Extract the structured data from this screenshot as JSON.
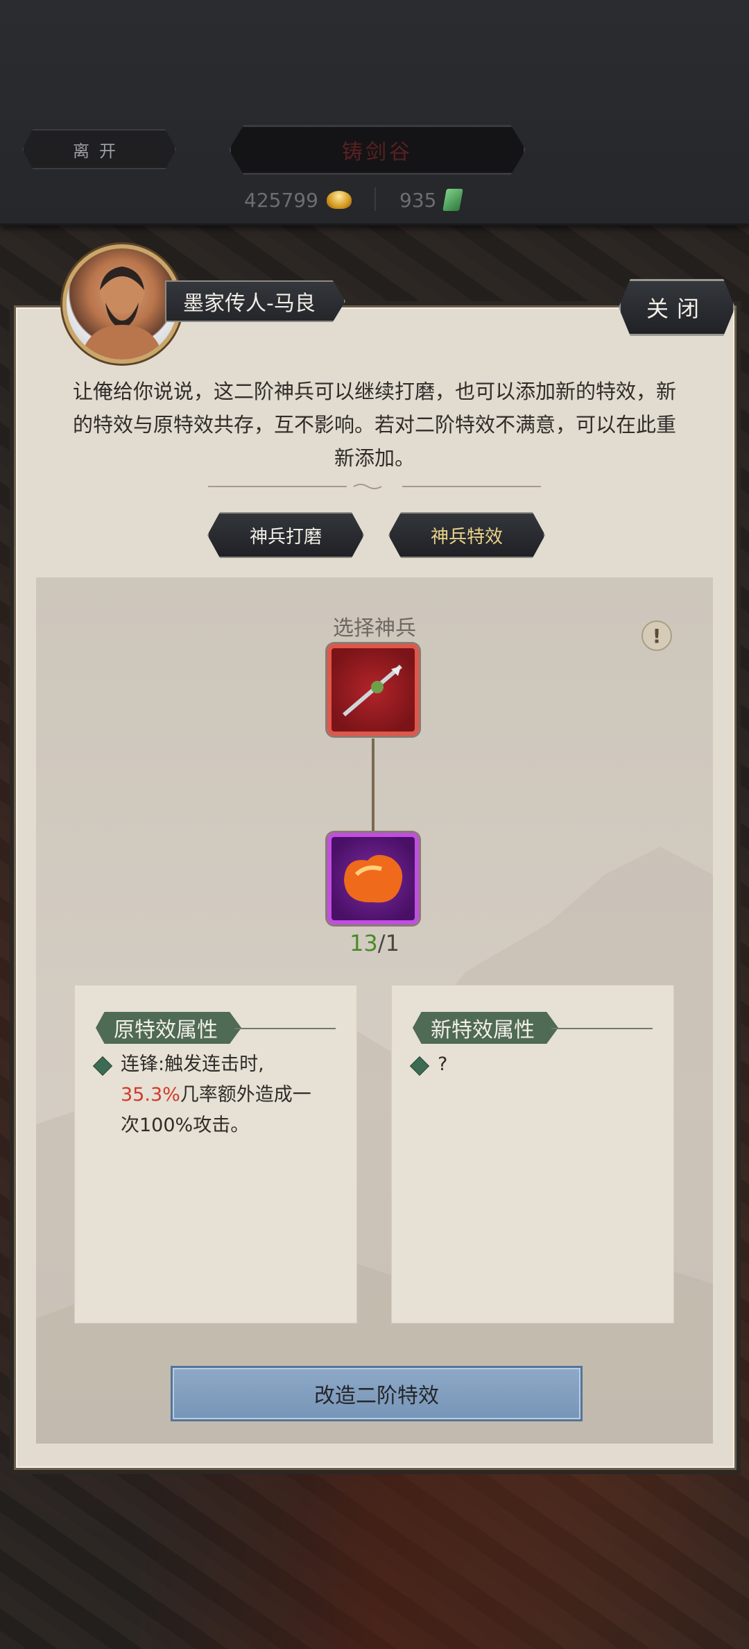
{
  "topbar": {
    "leave_label": "离开",
    "location_title": "铸剑谷",
    "gold_amount": "425799",
    "jade_amount": "935"
  },
  "npc": {
    "name": "墨家传人-马良",
    "dialog": "让俺给你说说，这二阶神兵可以继续打磨，也可以添加新的特效，新的特效与原特效共存，互不影响。若对二阶特效不满意，可以在此重新添加。"
  },
  "close_label": "关闭",
  "tabs": [
    {
      "label": "神兵打磨",
      "active": false
    },
    {
      "label": "神兵特效",
      "active": true
    }
  ],
  "select_title": "选择神兵",
  "info_symbol": "!",
  "material": {
    "have": "13",
    "sep_need": "/1"
  },
  "original_effect": {
    "title": "原特效属性",
    "text_prefix": "连锋:触发连击时,",
    "percent": "35.3%",
    "text_suffix": "几率额外造成一次100%攻击。"
  },
  "new_effect": {
    "title": "新特效属性",
    "text": "?"
  },
  "action_label": "改造二阶特效"
}
